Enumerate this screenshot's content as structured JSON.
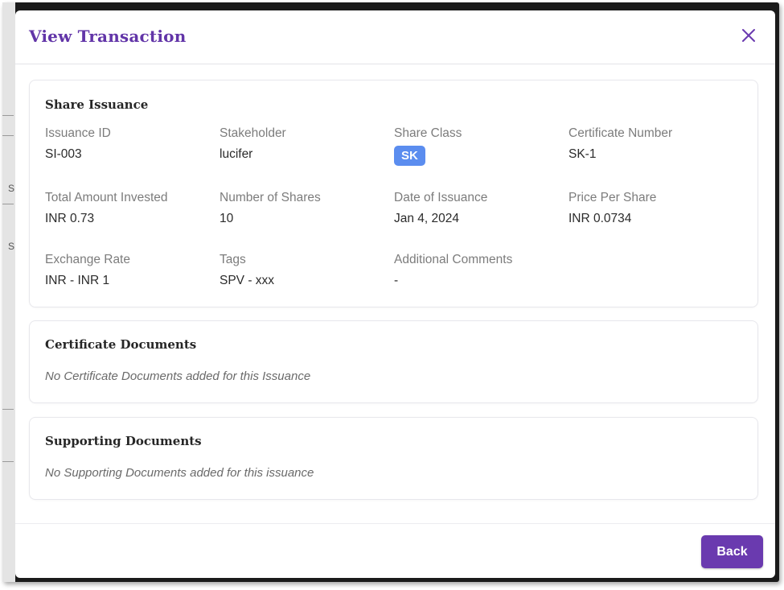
{
  "modal": {
    "title": "View Transaction",
    "close_icon": "close-icon",
    "accent_color": "#6235a8"
  },
  "share_issuance": {
    "title": "Share Issuance",
    "fields": [
      {
        "label": "Issuance ID",
        "value": "SI-003"
      },
      {
        "label": "Stakeholder",
        "value": "lucifer"
      },
      {
        "label": "Share Class",
        "value": "SK"
      },
      {
        "label": "Certificate Number",
        "value": "SK-1"
      },
      {
        "label": "Total Amount Invested",
        "value": "INR 0.73"
      },
      {
        "label": "Number of Shares",
        "value": "10"
      },
      {
        "label": "Date of Issuance",
        "value": "Jan 4, 2024"
      },
      {
        "label": "Price Per Share",
        "value": "INR 0.0734"
      },
      {
        "label": "Exchange Rate",
        "value": "INR - INR 1"
      },
      {
        "label": "Tags",
        "value": "SPV - xxx"
      },
      {
        "label": "Additional Comments",
        "value": "-"
      }
    ],
    "badge_color": "#5b8def"
  },
  "certificate_documents": {
    "title": "Certificate Documents",
    "empty_message": "No Certificate Documents added for this Issuance"
  },
  "supporting_documents": {
    "title": "Supporting Documents",
    "empty_message": "No Supporting Documents added for this issuance"
  },
  "footer": {
    "back_label": "Back",
    "button_color": "#6a3aaf"
  },
  "backdrop": {
    "edge_glyph": "S"
  }
}
